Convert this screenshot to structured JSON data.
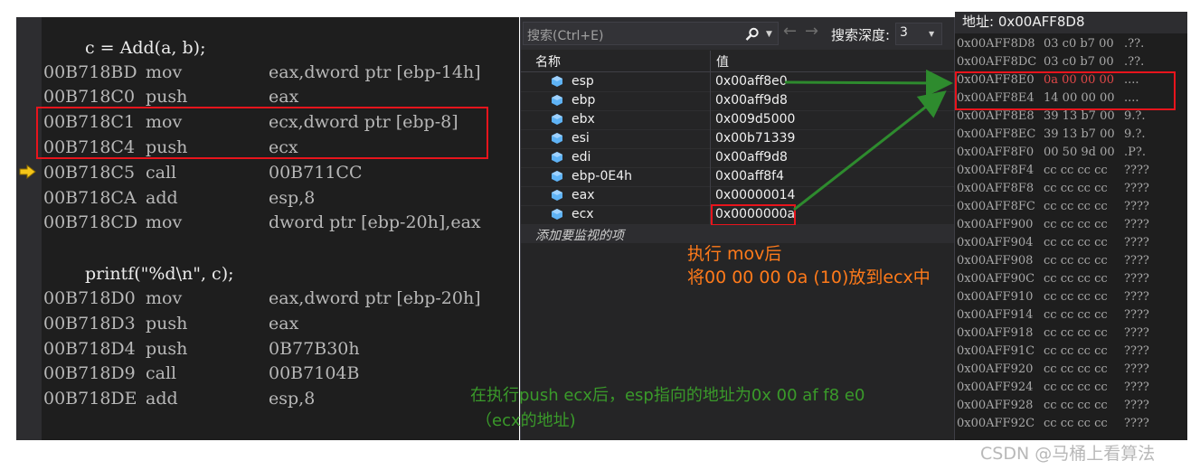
{
  "disassembly": {
    "source_lines": [
      "c = Add(a, b);",
      "printf(\"%d\\n\", c);"
    ],
    "block1": [
      {
        "addr": "00B718BD",
        "op": "mov",
        "arg": "eax,dword ptr [ebp-14h]"
      },
      {
        "addr": "00B718C0",
        "op": "push",
        "arg": "eax"
      },
      {
        "addr": "00B718C1",
        "op": "mov",
        "arg": "ecx,dword ptr [ebp-8]"
      },
      {
        "addr": "00B718C4",
        "op": "push",
        "arg": "ecx"
      },
      {
        "addr": "00B718C5",
        "op": "call",
        "arg": "00B711CC"
      },
      {
        "addr": "00B718CA",
        "op": "add",
        "arg": "esp,8"
      },
      {
        "addr": "00B718CD",
        "op": "mov",
        "arg": "dword ptr [ebp-20h],eax"
      }
    ],
    "block2": [
      {
        "addr": "00B718D0",
        "op": "mov",
        "arg": "eax,dword ptr [ebp-20h]"
      },
      {
        "addr": "00B718D3",
        "op": "push",
        "arg": "eax"
      },
      {
        "addr": "00B718D4",
        "op": "push",
        "arg": "0B77B30h"
      },
      {
        "addr": "00B718D9",
        "op": "call",
        "arg": "00B7104B"
      },
      {
        "addr": "00B718DE",
        "op": "add",
        "arg": "esp,8"
      }
    ],
    "current_icon": "current-instruction-arrow-icon"
  },
  "watch": {
    "search_placeholder": "搜索(Ctrl+E)",
    "depth_label": "搜索深度:",
    "depth_value": "3",
    "columns": {
      "name": "名称",
      "value": "值"
    },
    "rows": [
      {
        "name": "esp",
        "value": "0x00aff8e0"
      },
      {
        "name": "ebp",
        "value": "0x00aff9d8"
      },
      {
        "name": "ebx",
        "value": "0x009d5000"
      },
      {
        "name": "esi",
        "value": "0x00b71339"
      },
      {
        "name": "edi",
        "value": "0x00aff9d8"
      },
      {
        "name": "ebp-0E4h",
        "value": "0x00aff8f4"
      },
      {
        "name": "eax",
        "value": "0x00000014"
      },
      {
        "name": "ecx",
        "value": "0x0000000a"
      }
    ],
    "add_item_label": "添加要监视的项"
  },
  "memory": {
    "address_label": "地址: 0x00AFF8D8",
    "rows": [
      {
        "addr": "0x00AFF8D8",
        "bytes": "03 c0 b7 00",
        "ascii": ".??."
      },
      {
        "addr": "0x00AFF8DC",
        "bytes": "03 c0 b7 00",
        "ascii": ".??."
      },
      {
        "addr": "0x00AFF8E0",
        "bytes": "0a 00 00 00",
        "ascii": "....",
        "highlight": true
      },
      {
        "addr": "0x00AFF8E4",
        "bytes": "14 00 00 00",
        "ascii": "...."
      },
      {
        "addr": "0x00AFF8E8",
        "bytes": "39 13 b7 00",
        "ascii": "9.?."
      },
      {
        "addr": "0x00AFF8EC",
        "bytes": "39 13 b7 00",
        "ascii": "9.?."
      },
      {
        "addr": "0x00AFF8F0",
        "bytes": "00 50 9d 00",
        "ascii": ".P?."
      },
      {
        "addr": "0x00AFF8F4",
        "bytes": "cc cc cc cc",
        "ascii": "????"
      },
      {
        "addr": "0x00AFF8F8",
        "bytes": "cc cc cc cc",
        "ascii": "????"
      },
      {
        "addr": "0x00AFF8FC",
        "bytes": "cc cc cc cc",
        "ascii": "????"
      },
      {
        "addr": "0x00AFF900",
        "bytes": "cc cc cc cc",
        "ascii": "????"
      },
      {
        "addr": "0x00AFF904",
        "bytes": "cc cc cc cc",
        "ascii": "????"
      },
      {
        "addr": "0x00AFF908",
        "bytes": "cc cc cc cc",
        "ascii": "????"
      },
      {
        "addr": "0x00AFF90C",
        "bytes": "cc cc cc cc",
        "ascii": "????"
      },
      {
        "addr": "0x00AFF910",
        "bytes": "cc cc cc cc",
        "ascii": "????"
      },
      {
        "addr": "0x00AFF914",
        "bytes": "cc cc cc cc",
        "ascii": "????"
      },
      {
        "addr": "0x00AFF918",
        "bytes": "cc cc cc cc",
        "ascii": "????"
      },
      {
        "addr": "0x00AFF91C",
        "bytes": "cc cc cc cc",
        "ascii": "????"
      },
      {
        "addr": "0x00AFF920",
        "bytes": "cc cc cc cc",
        "ascii": "????"
      },
      {
        "addr": "0x00AFF924",
        "bytes": "cc cc cc cc",
        "ascii": "????"
      },
      {
        "addr": "0x00AFF928",
        "bytes": "cc cc cc cc",
        "ascii": "????"
      },
      {
        "addr": "0x00AFF92C",
        "bytes": "cc cc cc cc",
        "ascii": "????"
      }
    ]
  },
  "annotations": {
    "orange_line1": "执行 mov后",
    "orange_line2": "将00 00 00 0a (10)放到ecx中",
    "green_line1": "在执行push ecx后，esp指向的地址为0x 00 af f8 e0",
    "green_line2": "（ecx的地址)"
  },
  "colors": {
    "highlight_box": "#e8141c",
    "annotation_orange": "#ff7a1a",
    "annotation_green": "#3a9a2a"
  },
  "watermark": "CSDN @马桶上看算法"
}
